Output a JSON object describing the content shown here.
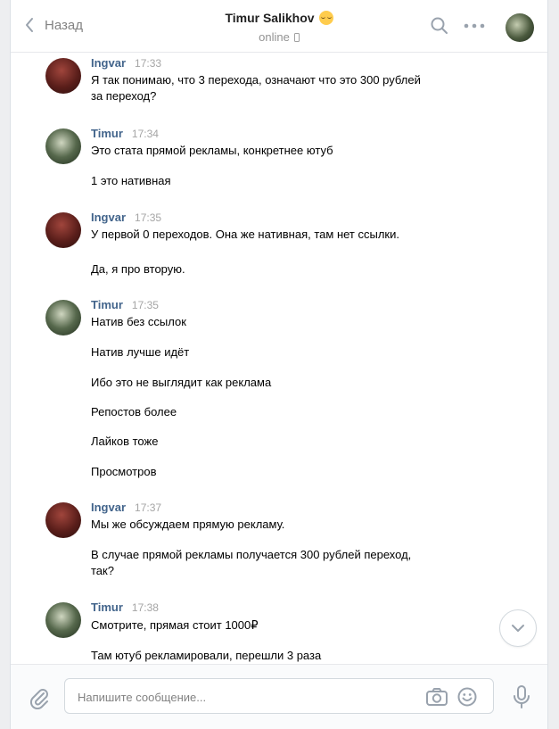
{
  "header": {
    "back_label": "Назад",
    "peer_name": "Timur Salikhov",
    "peer_status": "online"
  },
  "messages": [
    {
      "author": "Ingvar",
      "time": "17:33",
      "avatar": "ingvar",
      "lines": [
        "Я так понимаю, что 3 перехода, означают что это 300 рублей",
        "за переход?"
      ]
    },
    {
      "author": "Timur",
      "time": "17:34",
      "avatar": "timur",
      "lines": [
        "Это стата прямой рекламы, конкретнее ютуб",
        "1 это нативная"
      ]
    },
    {
      "author": "Ingvar",
      "time": "17:35",
      "avatar": "ingvar",
      "lines": [
        "У первой 0 переходов. Она же нативная, там нет ссылки.",
        "Да, я про вторую."
      ]
    },
    {
      "author": "Timur",
      "time": "17:35",
      "avatar": "timur",
      "lines": [
        "Натив без ссылок",
        "Натив лучше идёт",
        "Ибо это не выглядит как реклама",
        "Репостов более",
        "Лайков тоже",
        "Просмотров"
      ]
    },
    {
      "author": "Ingvar",
      "time": "17:37",
      "avatar": "ingvar",
      "lines": [
        "Мы же обсуждаем прямую рекламу.",
        "В случае прямой рекламы получается 300 рублей переход,",
        "так?"
      ]
    },
    {
      "author": "Timur",
      "time": "17:38",
      "avatar": "timur",
      "lines": [
        "Смотрите, прямая стоит 1000₽",
        "Там ютуб рекламировали, перешли 3 раза"
      ]
    }
  ],
  "composer": {
    "placeholder": "Напишите сообщение..."
  },
  "colors": {
    "author_link": "#42648b",
    "time": "#a5a5a5",
    "page_bg": "#edeef0"
  },
  "icons": [
    "chevron-left-icon",
    "phone-icon",
    "search-icon",
    "more-icon",
    "chevron-down-icon",
    "paperclip-icon",
    "camera-icon",
    "smile-icon",
    "microphone-icon"
  ]
}
